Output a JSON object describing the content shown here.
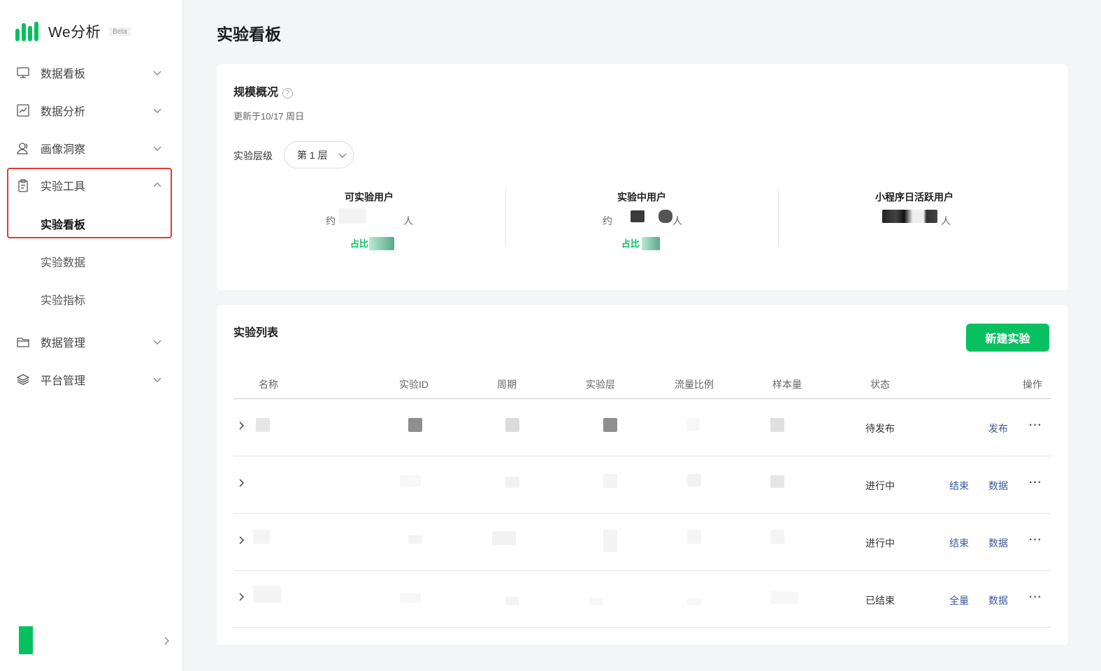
{
  "app": {
    "name": "We分析",
    "badge": "Beta"
  },
  "sidebar": {
    "items": [
      {
        "label": "数据看板",
        "icon": "monitor-icon",
        "expanded": false
      },
      {
        "label": "数据分析",
        "icon": "chart-icon",
        "expanded": false
      },
      {
        "label": "画像洞察",
        "icon": "user-icon",
        "expanded": false
      },
      {
        "label": "实验工具",
        "icon": "clipboard-icon",
        "expanded": true
      },
      {
        "label": "数据管理",
        "icon": "folder-icon",
        "expanded": false
      },
      {
        "label": "平台管理",
        "icon": "layers-icon",
        "expanded": false
      }
    ],
    "subitems": [
      {
        "label": "实验看板",
        "active": true
      },
      {
        "label": "实验数据",
        "active": false
      },
      {
        "label": "实验指标",
        "active": false
      }
    ]
  },
  "page": {
    "title": "实验看板"
  },
  "overview": {
    "title": "规模概况",
    "help": "?",
    "updated": "更新于10/17 周日",
    "layer_label": "实验层级",
    "layer_value": "第 1 层",
    "stats": [
      {
        "label": "可实验用户",
        "prefix": "约",
        "suffix": "人",
        "ratio_label": "占比"
      },
      {
        "label": "实验中用户",
        "prefix": "约",
        "suffix": "人",
        "ratio_label": "占比"
      },
      {
        "label": "小程序日活跃用户",
        "prefix": "",
        "suffix": "人",
        "ratio_label": ""
      }
    ]
  },
  "experiments": {
    "title": "实验列表",
    "new_button": "新建实验",
    "columns": [
      "名称",
      "实验ID",
      "周期",
      "实验层",
      "流量比例",
      "样本量",
      "状态",
      "操作"
    ],
    "rows": [
      {
        "status": "待发布",
        "actions": [
          "发布"
        ],
        "more": "···"
      },
      {
        "status": "进行中",
        "actions": [
          "结束",
          "数据"
        ],
        "more": "···"
      },
      {
        "status": "进行中",
        "actions": [
          "结束",
          "数据"
        ],
        "more": "···"
      },
      {
        "status": "已结束",
        "actions": [
          "全量",
          "数据"
        ],
        "more": "···"
      }
    ]
  },
  "colors": {
    "brand": "#07c160",
    "link": "#3b5998",
    "highlight": "#e53935"
  }
}
